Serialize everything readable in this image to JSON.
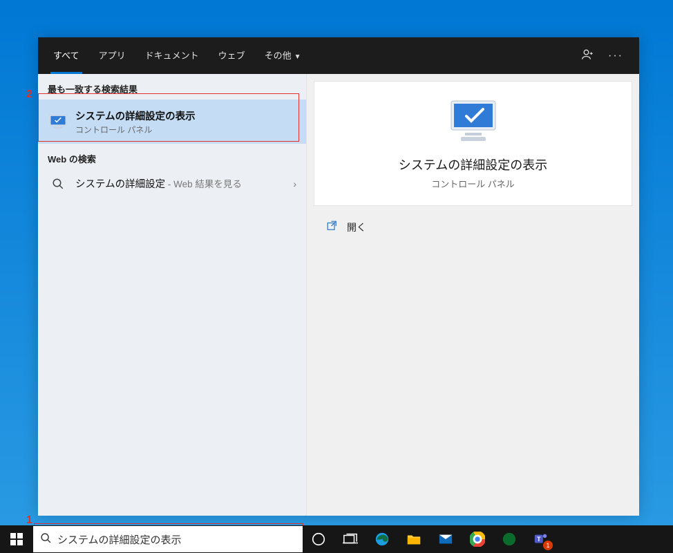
{
  "annotations": {
    "n1": "1",
    "n2": "2"
  },
  "header": {
    "tabs": [
      "すべて",
      "アプリ",
      "ドキュメント",
      "ウェブ"
    ],
    "more": "その他"
  },
  "left": {
    "best_match_hdr": "最も一致する検索結果",
    "best_match": {
      "title": "システムの詳細設定の表示",
      "subtitle": "コントロール パネル"
    },
    "web_hdr": "Web の検索",
    "web_item": {
      "query": "システムの詳細設定",
      "tail": " - Web 結果を見る"
    }
  },
  "detail": {
    "title": "システムの詳細設定の表示",
    "subtitle": "コントロール パネル",
    "open": "開く"
  },
  "search_input": "システムの詳細設定の表示",
  "teams_badge": "1"
}
